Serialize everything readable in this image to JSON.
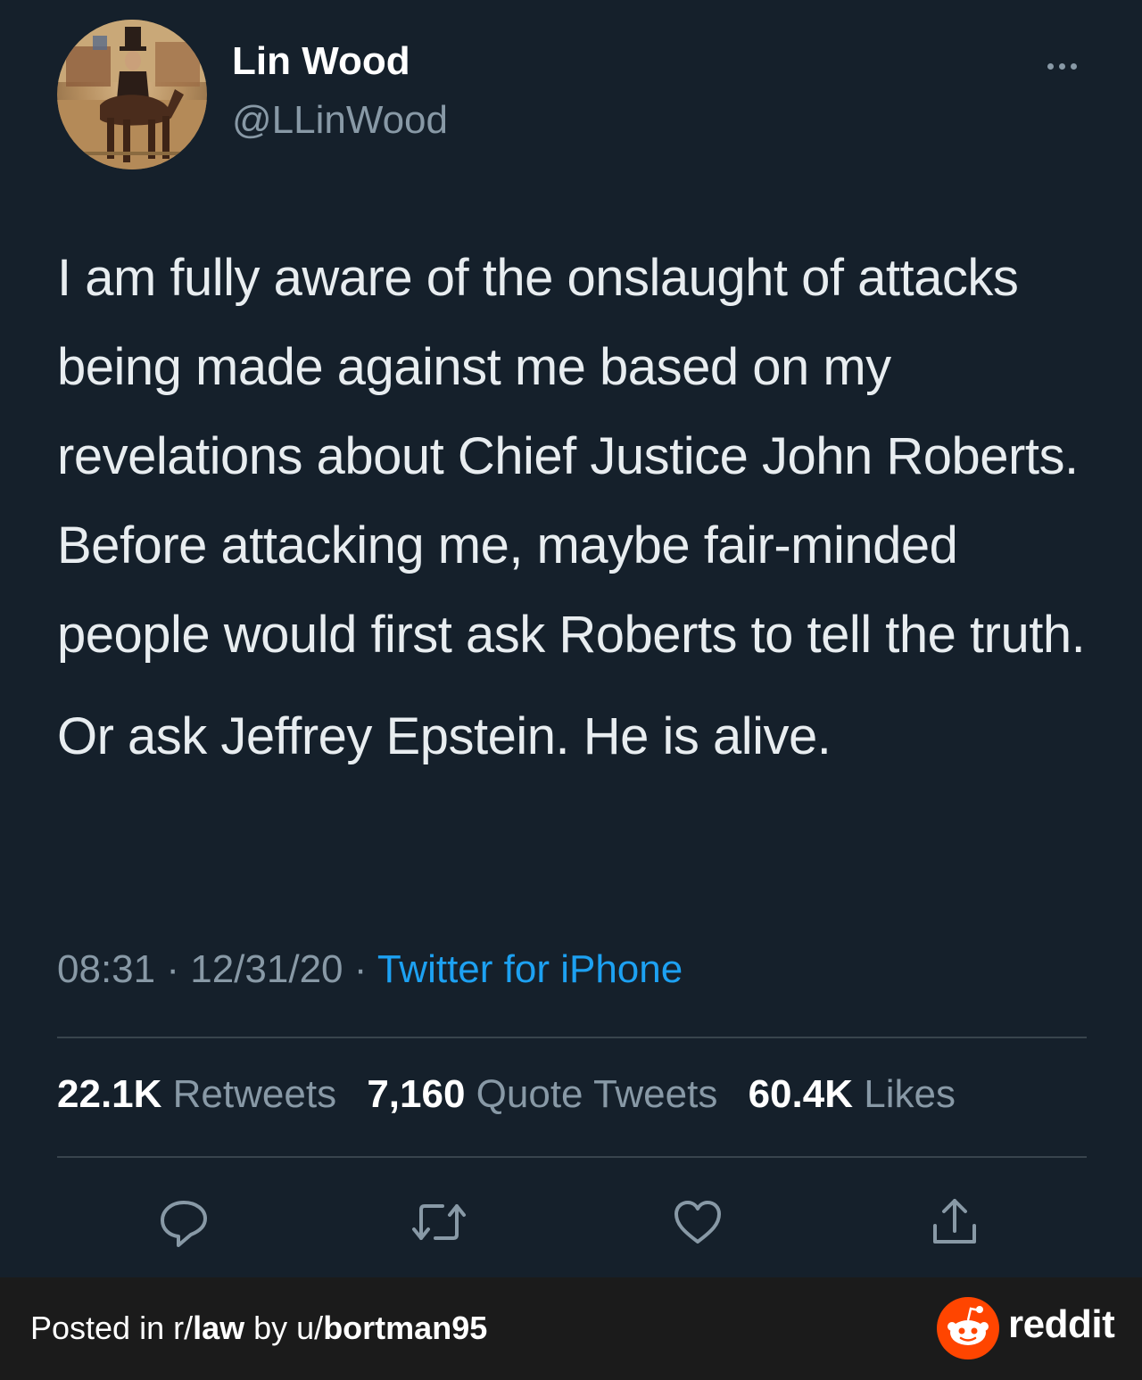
{
  "tweet": {
    "display_name": "Lin Wood",
    "handle": "@LLinWood",
    "avatar_icon": "horse-rider-avatar",
    "more_icon": "more-options-icon",
    "paragraphs": [
      "I am fully aware of the onslaught of attacks being made against me based on my revelations about Chief Justice John Roberts. Before attacking me, maybe fair-minded people would first ask Roberts to tell the truth.",
      "Or ask Jeffrey Epstein. He is alive."
    ],
    "time": "08:31",
    "separator": "·",
    "date": "12/31/20",
    "source": "Twitter for iPhone",
    "stats": {
      "retweets_count": "22.1K",
      "retweets_label": "Retweets",
      "quotes_count": "7,160",
      "quotes_label": "Quote Tweets",
      "likes_count": "60.4K",
      "likes_label": "Likes"
    },
    "actions": [
      "reply-icon",
      "retweet-icon",
      "like-icon",
      "share-icon"
    ]
  },
  "footer": {
    "posted_in": "Posted in r/",
    "subreddit": "law",
    "by": " by u/",
    "username": "bortman95",
    "brand": "reddit"
  },
  "colors": {
    "background": "#15202b",
    "link": "#1da1f2",
    "secondary_text": "#8899a6",
    "footer_bg": "#1b1b1b",
    "reddit_orange": "#ff4500"
  }
}
